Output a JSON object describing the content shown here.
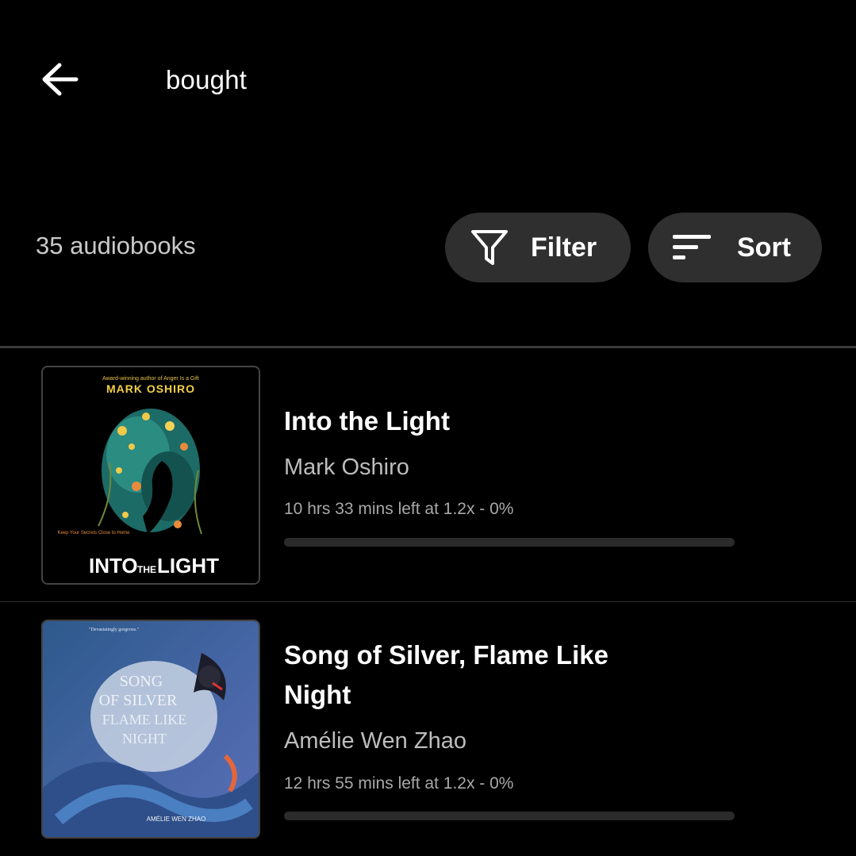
{
  "header": {
    "back_icon": "arrow-left-icon",
    "title": "bought"
  },
  "toolbar": {
    "count_label": "35 audiobooks",
    "filter": {
      "icon": "filter-funnel-icon",
      "label": "Filter"
    },
    "sort": {
      "icon": "sort-lines-icon",
      "label": "Sort"
    }
  },
  "books": [
    {
      "title": "Into the Light",
      "author": "Mark Oshiro",
      "meta": "10 hrs 33 mins left at 1.2x - 0%",
      "progress_fraction": 0,
      "cover": {
        "tagline": "Award-winning author of Anger Is a Gift",
        "author_text": "MARK OSHIRO",
        "blurb": "Keep Your Secrets Close to Home",
        "title_word_1": "INTO",
        "title_word_2": "THE",
        "title_word_3": "LIGHT"
      }
    },
    {
      "title": "Song of Silver, Flame Like Night",
      "author": "Amélie Wen Zhao",
      "meta": "12 hrs 55 mins left at 1.2x - 0%",
      "progress_fraction": 0,
      "cover": {
        "quote": "\"Devastatingly gorgeous.\"",
        "title_line_1": "SONG",
        "title_line_2": "OF SILVER",
        "title_line_3": "FLAME LIKE",
        "title_line_4": "NIGHT",
        "author_text": "AMÉLIE WEN ZHAO"
      }
    }
  ],
  "colors": {
    "background": "#000000",
    "pill_background": "#2f2f2f",
    "secondary_text": "#bdbdbd",
    "cover1_author_yellow": "#f2d04a"
  }
}
